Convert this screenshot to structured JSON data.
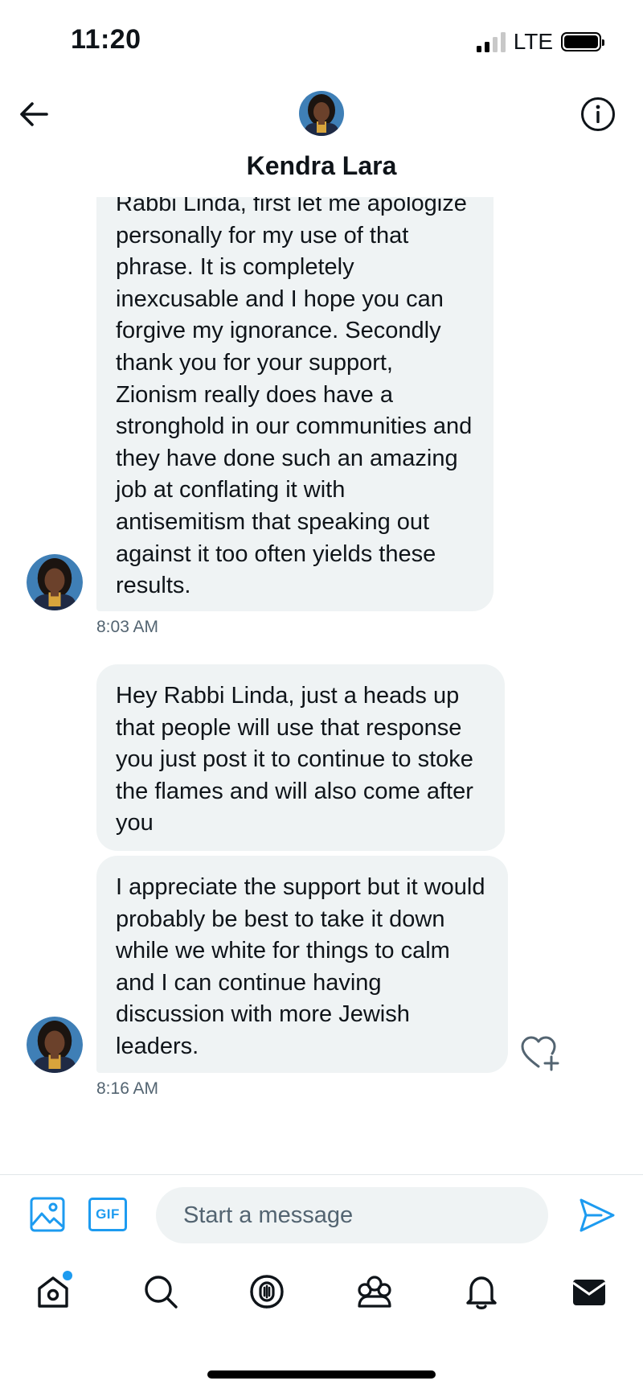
{
  "status_bar": {
    "time": "11:20",
    "network": "LTE"
  },
  "header": {
    "contact_name": "Kendra Lara",
    "back_icon": "arrow-left-icon",
    "info_icon": "info-icon"
  },
  "messages": [
    {
      "text": "Rabbi Linda, first let me apologize personally for my use of that phrase. It is completely inexcusable and I hope you can forgive my ignorance. Secondly thank you for your support, Zionism really does have a stronghold in our communities and they have done such an amazing job at conflating it with antisemitism that speaking out against it too often yields these results.",
      "time": "8:03 AM"
    },
    {
      "text": "Hey Rabbi Linda, just a heads up that people will use that response you just post it to continue to stoke the flames and will also come after you"
    },
    {
      "text": "I appreciate the support but it would probably be best to take it down while we white for things to calm and I can continue having discussion with more Jewish leaders.",
      "time": "8:16 AM"
    }
  ],
  "composer": {
    "placeholder": "Start a message",
    "gif_label": "GIF"
  },
  "colors": {
    "accent": "#1d9bf0",
    "bubble_bg": "#eff3f4",
    "timestamp": "#536471"
  },
  "nav": {
    "items": [
      "home-icon",
      "search-icon",
      "spaces-icon",
      "communities-icon",
      "notifications-icon",
      "messages-icon"
    ],
    "active": "messages-icon"
  }
}
